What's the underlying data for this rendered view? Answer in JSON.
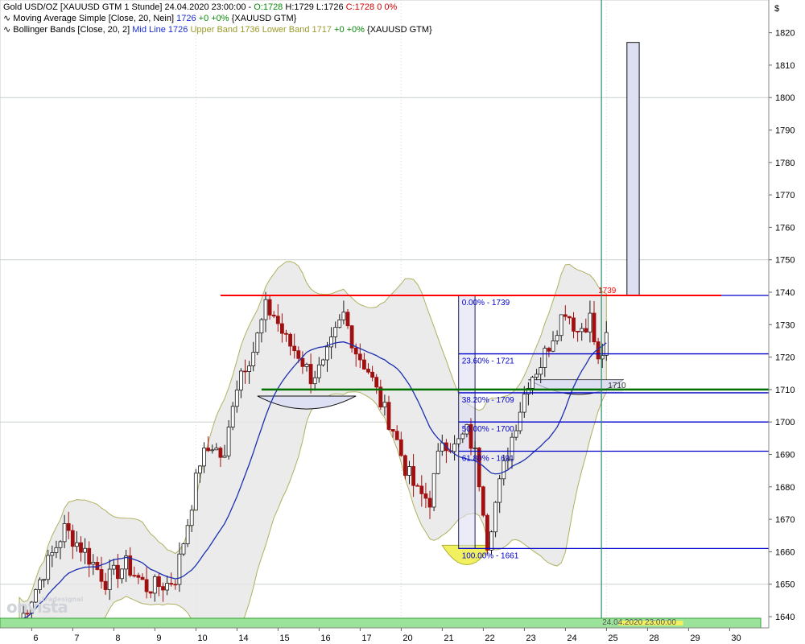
{
  "header": {
    "line1": {
      "name": "Gold USD/OZ [XAUUSD GTM  1 Stunde] 24.04.2020 23:00:00 -",
      "o": "O:1728",
      "h": "H:1729",
      "l": "L:1726",
      "c": "C:1728",
      "chg": "0 0%"
    },
    "line2": {
      "name": "Moving Average Simple [Close, 20, Nein]",
      "val": "1726",
      "chg": "+0 +0%",
      "sym": "{XAUUSD GTM}"
    },
    "line3": {
      "name": "Bollinger Bands [Close, 20, 2]",
      "mid": "Mid Line 1726",
      "upper": "Upper Band 1736",
      "lower": "Lower Band 1717",
      "chg": "+0 +0%",
      "sym": "{XAUUSD GTM}"
    }
  },
  "currency_symbol": "$",
  "watermark": {
    "main": "onvista",
    "sub": "tradesignal"
  },
  "colors": {
    "resistance": "#ff0000",
    "support": "#007000",
    "fib": "#0000cc",
    "ma": "#1c2fb0",
    "band_fill": "#e6e6e6",
    "band_edge": "#b0b060",
    "candle_up": "#1a1a1a",
    "candle_down": "#a01010",
    "vline": "#2e8b6b"
  },
  "chart_data": {
    "type": "candlestick",
    "ylim": [
      1635,
      1830
    ],
    "y_ticks": [
      1640,
      1650,
      1660,
      1670,
      1680,
      1690,
      1700,
      1710,
      1720,
      1730,
      1740,
      1750,
      1760,
      1770,
      1780,
      1790,
      1800,
      1810,
      1820
    ],
    "x_ticks": [
      "6",
      "7",
      "8",
      "9",
      "10",
      "14",
      "15",
      "16",
      "17",
      "20",
      "21",
      "22",
      "23",
      "24",
      "25",
      "28",
      "29",
      "30"
    ],
    "x_tick_index": [
      4,
      14,
      24,
      34,
      44,
      54,
      64,
      74,
      84,
      94,
      104,
      114,
      124,
      134,
      144,
      154,
      164,
      174
    ],
    "num_bars": 178,
    "anchors": [
      [
        0,
        1638
      ],
      [
        6,
        1654
      ],
      [
        11,
        1667
      ],
      [
        16,
        1660
      ],
      [
        21,
        1651
      ],
      [
        26,
        1656
      ],
      [
        31,
        1649
      ],
      [
        36,
        1650
      ],
      [
        38,
        1652
      ],
      [
        41,
        1669
      ],
      [
        44,
        1688
      ],
      [
        47,
        1693
      ],
      [
        50,
        1688
      ],
      [
        52,
        1707
      ],
      [
        54,
        1716
      ],
      [
        57,
        1722
      ],
      [
        60,
        1735
      ],
      [
        62,
        1733
      ],
      [
        65,
        1725
      ],
      [
        68,
        1721
      ],
      [
        71,
        1714
      ],
      [
        74,
        1717
      ],
      [
        77,
        1727
      ],
      [
        79,
        1733
      ],
      [
        82,
        1722
      ],
      [
        85,
        1716
      ],
      [
        88,
        1706
      ],
      [
        91,
        1698
      ],
      [
        94,
        1686
      ],
      [
        97,
        1678
      ],
      [
        100,
        1676
      ],
      [
        103,
        1695
      ],
      [
        106,
        1692
      ],
      [
        109,
        1697
      ],
      [
        111,
        1690
      ],
      [
        113,
        1674
      ],
      [
        114,
        1663
      ],
      [
        116,
        1675
      ],
      [
        118,
        1686
      ],
      [
        121,
        1700
      ],
      [
        124,
        1713
      ],
      [
        127,
        1718
      ],
      [
        130,
        1727
      ],
      [
        133,
        1735
      ],
      [
        136,
        1728
      ],
      [
        139,
        1732
      ],
      [
        141,
        1718
      ],
      [
        143,
        1725
      ]
    ],
    "annotations": {
      "resistance": {
        "value": 1739,
        "label": "1739",
        "x_index": [
          49,
          171
        ]
      },
      "support": {
        "value": 1710,
        "label": "1710",
        "x_index": [
          59,
          178
        ]
      },
      "fibonacci": [
        {
          "value": 1739,
          "label": "0.00% - 1739"
        },
        {
          "value": 1721,
          "label": "23.60% - 1721"
        },
        {
          "value": 1709,
          "label": "38.20% - 1709"
        },
        {
          "value": 1700,
          "label": "50.00% - 1700"
        },
        {
          "value": 1691,
          "label": "61.80% - 1691"
        },
        {
          "value": 1661,
          "label": "100.00% - 1661"
        }
      ],
      "fib_box_x_index": [
        107,
        111
      ],
      "projection_box": {
        "x_index": [
          148,
          151
        ],
        "y": [
          1739,
          1817
        ]
      },
      "current_bar_index": 141,
      "bottom_label": "24.04.2020 23:00:00"
    }
  }
}
